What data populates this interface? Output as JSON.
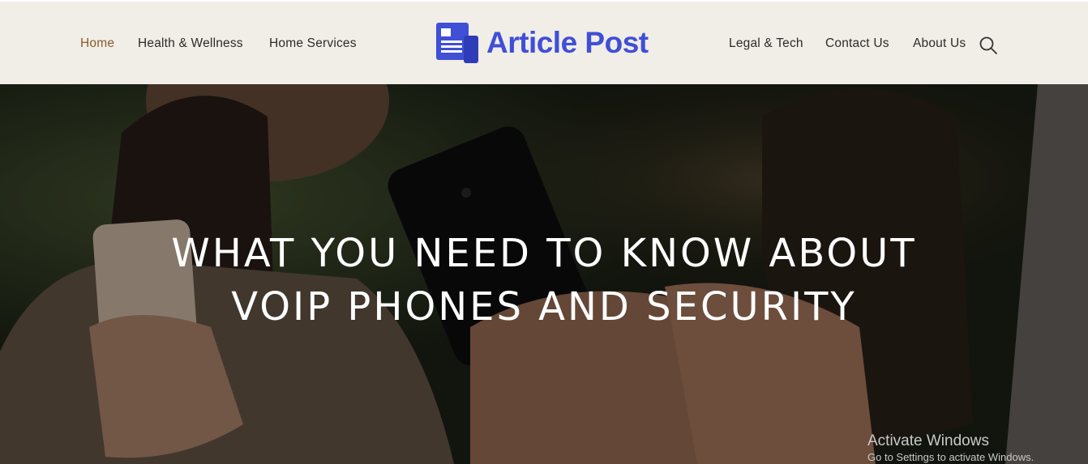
{
  "nav_left": [
    {
      "label": "Home",
      "active": true
    },
    {
      "label": "Health & Wellness",
      "active": false
    },
    {
      "label": "Home Services",
      "active": false
    }
  ],
  "logo": {
    "text": "Article Post",
    "icon": "newspaper-icon"
  },
  "nav_right": [
    {
      "label": "Legal & Tech"
    },
    {
      "label": "Contact Us"
    },
    {
      "label": "About Us"
    }
  ],
  "search": {
    "icon": "search-icon"
  },
  "hero": {
    "title_line1": "WHAT YOU NEED TO KNOW ABOUT",
    "title_line2": "VOIP PHONES AND SECURITY"
  },
  "watermark": {
    "line1": "Activate Windows",
    "line2": "Go to Settings to activate Windows."
  },
  "colors": {
    "header_bg": "#f1ede7",
    "active_link": "#8a5a2b",
    "brand": "#3f4fd6"
  }
}
